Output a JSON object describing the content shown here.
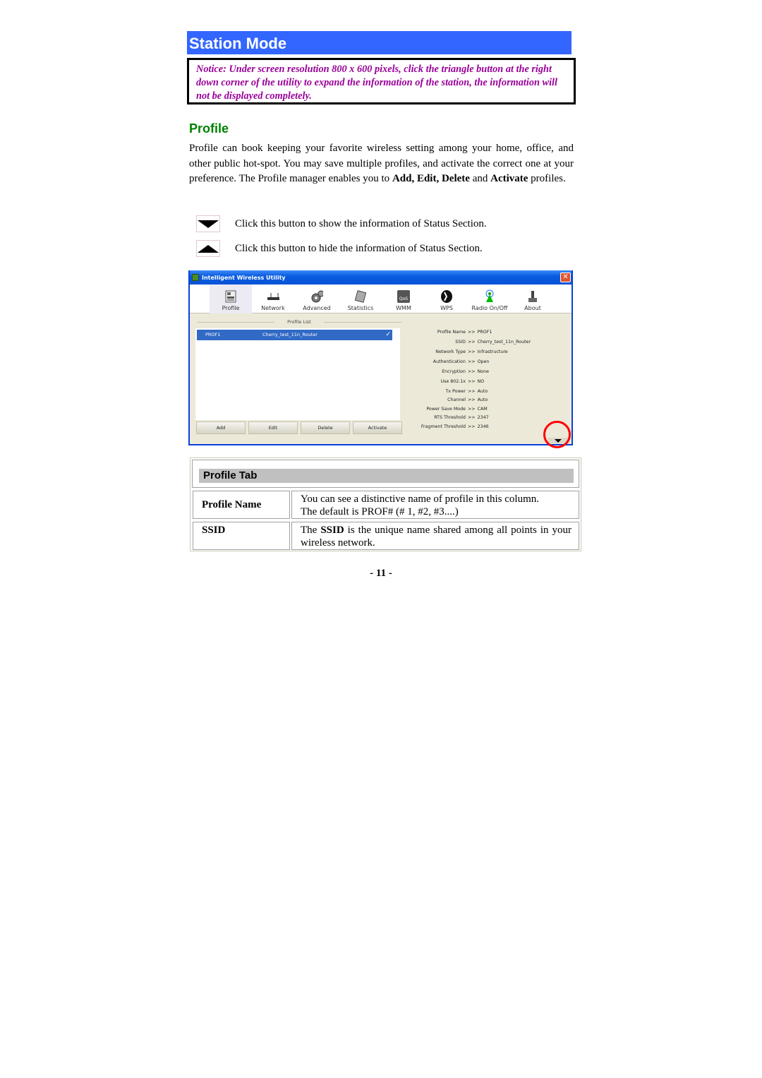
{
  "header": {
    "title": "Station Mode",
    "notice": "Notice: Under screen resolution 800 x 600 pixels, click the triangle button at the right down corner of the utility to expand the information of the station, the information will not be displayed completely."
  },
  "section": {
    "heading": "Profile",
    "paragraph": {
      "part1": "Profile can book keeping your favorite wireless setting among your home, office, and other public hot-spot. You may save multiple profiles, and activate the correct one at your preference. The Profile manager enables you to ",
      "bold1": "Add, Edit, Delete",
      "part2": " and ",
      "bold2": "Activate",
      "part3": " profiles."
    },
    "buttons": [
      {
        "icon": "triangle-down-icon",
        "text": "Click this button to show the information of Status Section."
      },
      {
        "icon": "triangle-up-icon",
        "text": "Click this button to hide the information of Status Section."
      }
    ]
  },
  "app": {
    "title": "Intelligent Wireless Utility",
    "close_glyph": "✕",
    "toolbar": [
      {
        "label": "Profile",
        "icon": "profile-icon",
        "active": true
      },
      {
        "label": "Network",
        "icon": "network-icon"
      },
      {
        "label": "Advanced",
        "icon": "advanced-icon"
      },
      {
        "label": "Statistics",
        "icon": "statistics-icon"
      },
      {
        "label": "WMM",
        "icon": "wmm-qos-icon"
      },
      {
        "label": "WPS",
        "icon": "wps-icon"
      },
      {
        "label": "Radio On/Off",
        "icon": "radio-icon"
      },
      {
        "label": "About",
        "icon": "about-icon"
      }
    ],
    "profile_list_label": "Profile List",
    "profiles": [
      {
        "name": "PROF1",
        "ssid": "Cherry_test_11n_Router",
        "status_icon": "connected-icon"
      }
    ],
    "buttons": {
      "add": "Add",
      "edit": "Edit",
      "delete": "Delete",
      "activate": "Activate"
    },
    "info": [
      {
        "key": "Profile Name",
        "value": "PROF1"
      },
      {
        "key": "SSID",
        "value": "Cherry_test_11n_Router"
      },
      {
        "key": "Network Type",
        "value": "Infrastructure"
      },
      {
        "key": "Authentication",
        "value": "Open"
      },
      {
        "key": "Encryption",
        "value": "None"
      },
      {
        "key": "Use 802.1x",
        "value": "NO"
      },
      {
        "key": "Tx Power",
        "value": "Auto"
      },
      {
        "key": "Channel",
        "value": "Auto"
      },
      {
        "key": "Power Save Mode",
        "value": "CAM"
      },
      {
        "key": "RTS Threshold",
        "value": "2347"
      },
      {
        "key": "Fragment Threshold",
        "value": "2346"
      }
    ],
    "info_separator": ">>"
  },
  "table": {
    "title": "Profile Tab",
    "rows": [
      {
        "key": "Profile Name",
        "value_line1": "You can see a distinctive name of profile in this column.",
        "value_line2": "The default is PROF# (# 1, #2, #3....)"
      },
      {
        "key": "SSID",
        "value_pre": "The ",
        "value_bold": "SSID",
        "value_post": " is the unique name shared among all points in your wireless network."
      }
    ]
  },
  "page_number": "- 11 -"
}
